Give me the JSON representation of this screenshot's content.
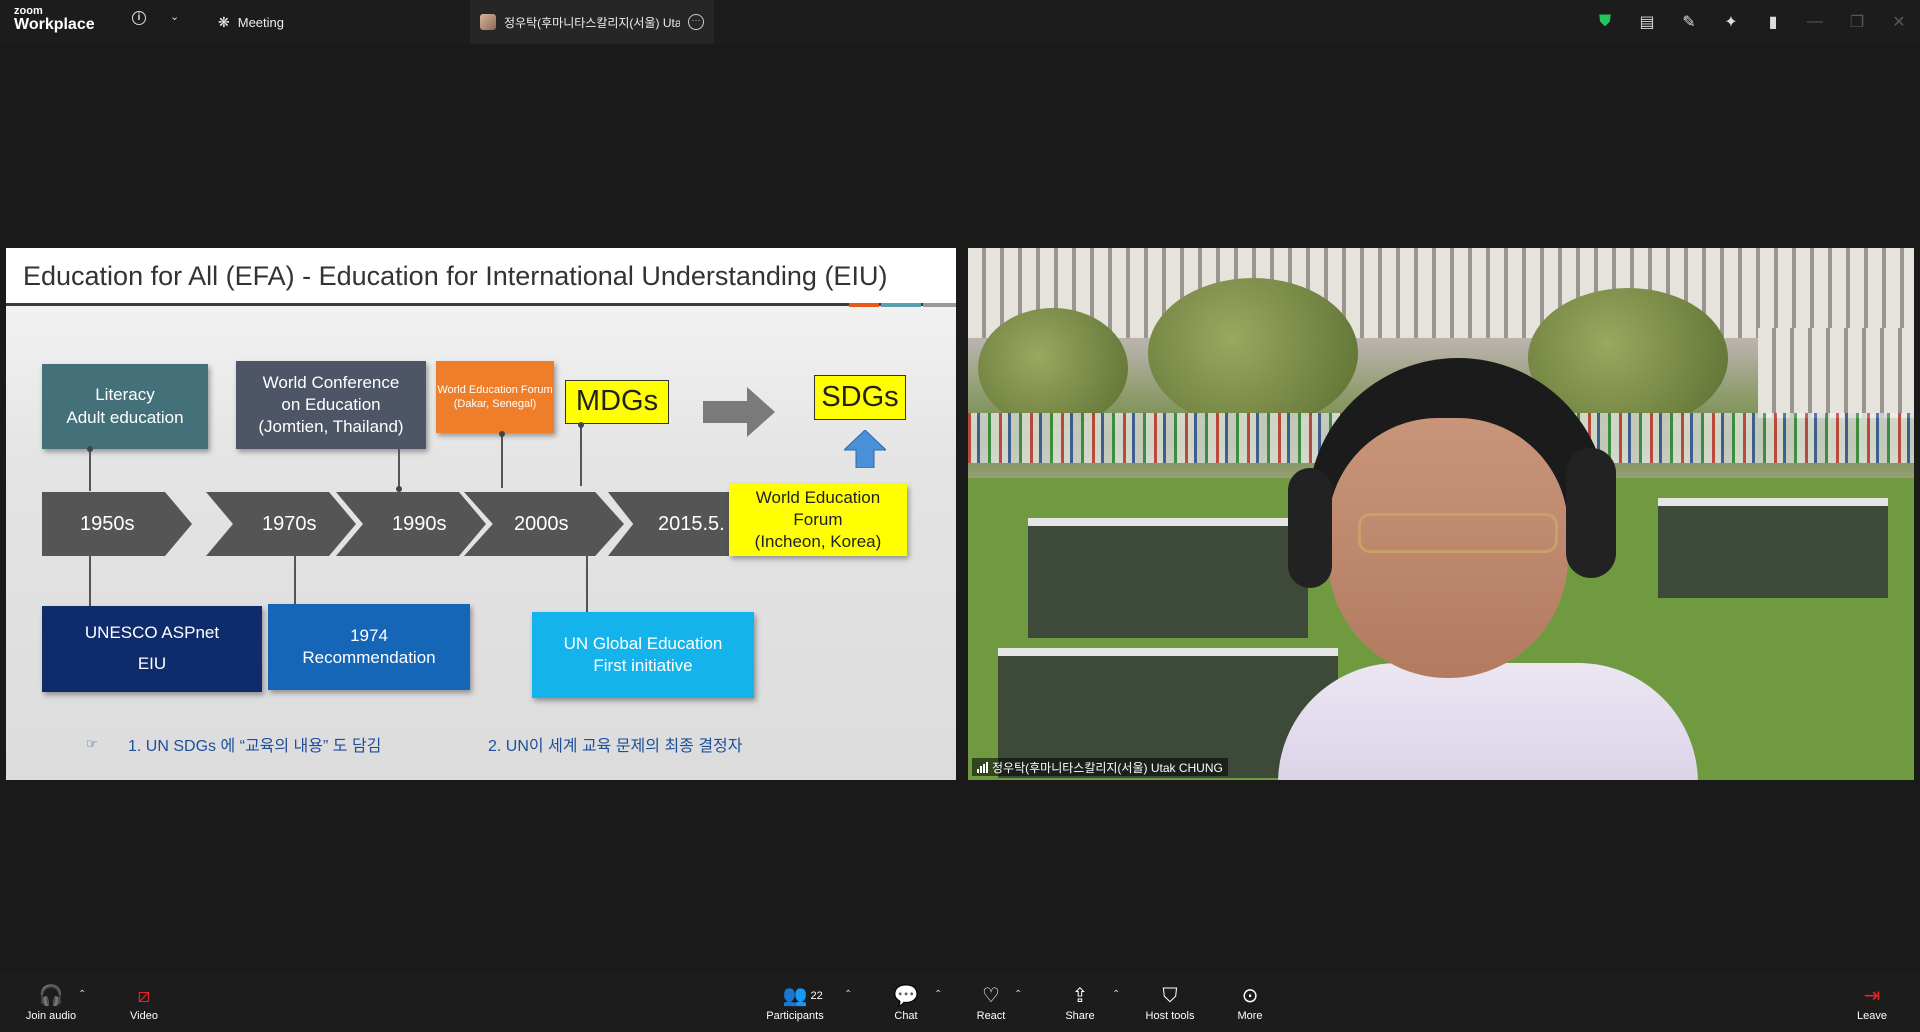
{
  "app": {
    "logo_small": "zoom",
    "logo_large": "Workplace",
    "meeting_tab_label": "Meeting",
    "active_tab_title": "정우탁(후마니타스칼리지(서울) Utak CHUNG"
  },
  "slide": {
    "title": "Education for All (EFA) - Education for International Understanding (EIU)",
    "top_boxes": [
      {
        "lines": [
          "Literacy",
          "Adult education"
        ],
        "bg": "#44707a"
      },
      {
        "lines": [
          "World Conference",
          "on Education",
          "(Jomtien, Thailand)"
        ],
        "bg": "#4d5566"
      },
      {
        "lines": [
          "World Education Forum",
          "(Dakar, Senegal)"
        ],
        "bg": "#ef7e2a"
      }
    ],
    "mdgs": "MDGs",
    "sdgs": "SDGs",
    "timeline": [
      "1950s",
      "1970s",
      "1990s",
      "2000s",
      "2015.5."
    ],
    "wef_incheon": [
      "World Education",
      "Forum",
      "(Incheon, Korea)"
    ],
    "bottom_boxes": [
      {
        "lines": [
          "UNESCO ASPnet",
          "EIU"
        ],
        "bg": "#0e2c6b"
      },
      {
        "lines": [
          "1974",
          "Recommendation"
        ],
        "bg": "#1666b8"
      },
      {
        "lines": [
          "UN Global Education",
          "First initiative"
        ],
        "bg": "#14b3ec"
      }
    ],
    "footnote_marker": "☞",
    "footnote_1": "1. UN SDGs 에 “교육의 내용” 도 담김",
    "footnote_2": "2. UN이 세계 교육 문제의 최종 결정자",
    "colors": {
      "yellow": "#ffff00",
      "chevron": "#555555",
      "arrow_blue": "#4a90d9"
    }
  },
  "video": {
    "participant_name": "정우탁(후마니타스칼리지(서울) Utak CHUNG"
  },
  "toolbar": {
    "join_audio": "Join audio",
    "video": "Video",
    "participants": "Participants",
    "participants_count": "22",
    "chat": "Chat",
    "react": "React",
    "share": "Share",
    "host_tools": "Host tools",
    "more": "More",
    "leave": "Leave"
  },
  "icons": [
    "info-icon",
    "chevron-down-icon",
    "paw-icon",
    "shield-icon",
    "notes-icon",
    "pen-icon",
    "sparkle-icon",
    "sidebar-icon",
    "minimize-icon",
    "restore-icon",
    "close-icon",
    "headphones-icon",
    "video-off-icon",
    "participants-icon",
    "chat-icon",
    "heart-icon",
    "share-icon",
    "host-shield-icon",
    "more-icon",
    "leave-icon"
  ]
}
